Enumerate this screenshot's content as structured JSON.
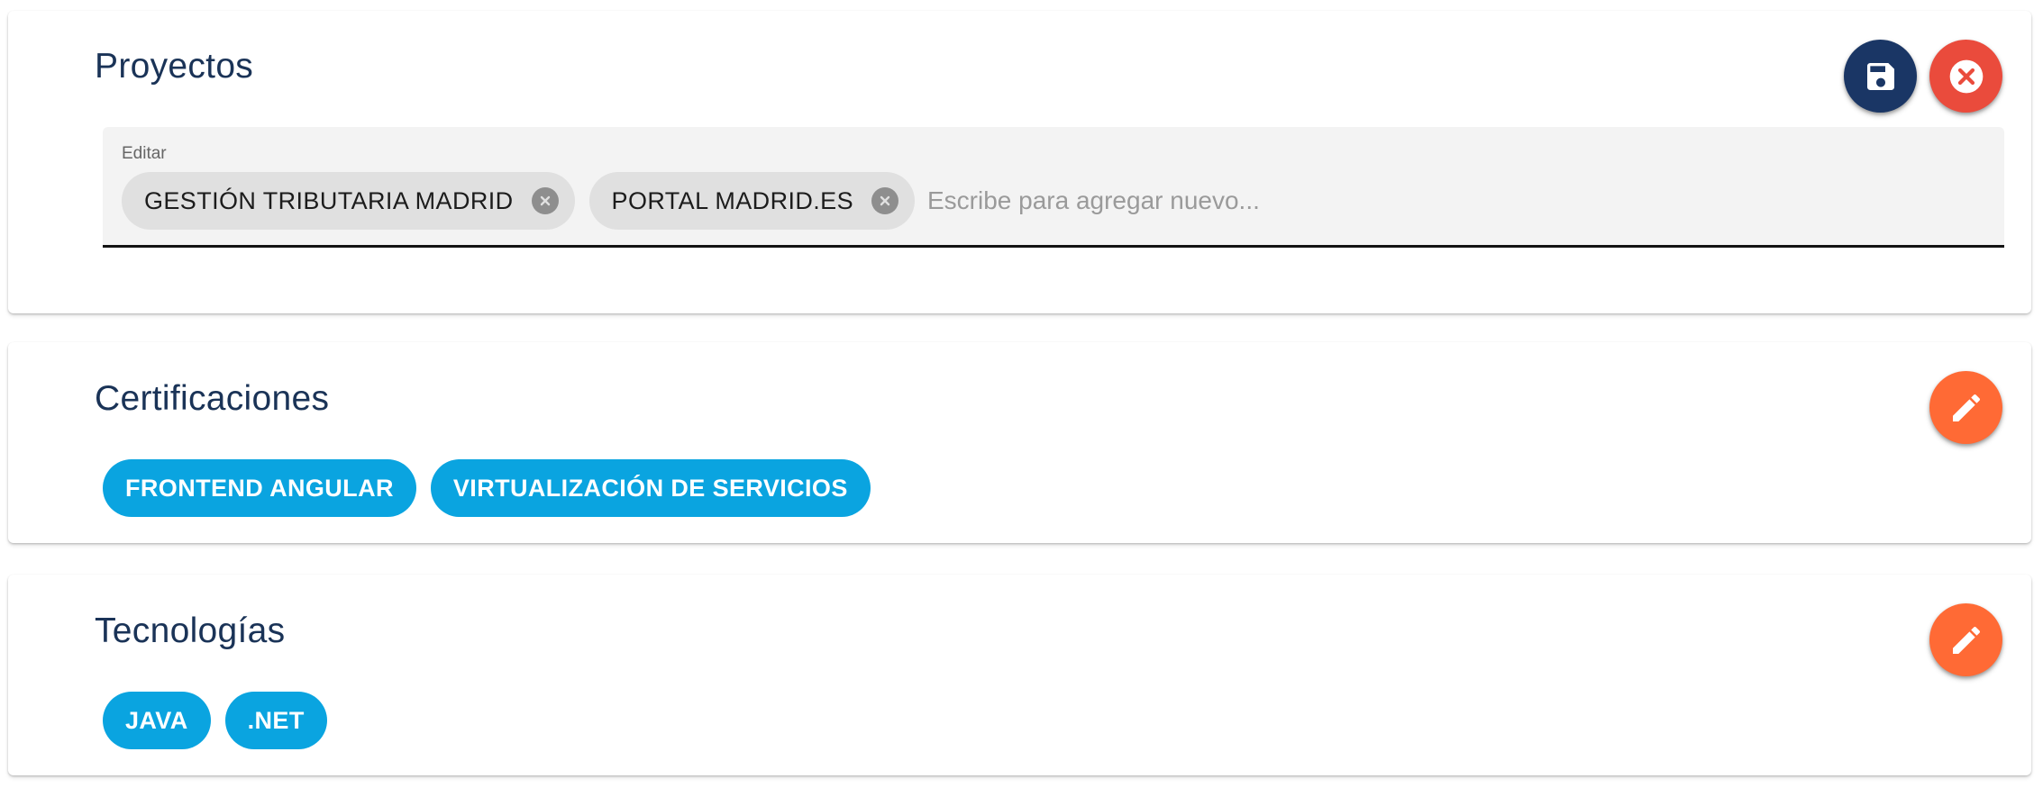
{
  "proyectos": {
    "title": "Proyectos",
    "field_label": "Editar",
    "chips": [
      "GESTIÓN TRIBUTARIA MADRID",
      "PORTAL MADRID.ES"
    ],
    "input_placeholder": "Escribe para agregar nuevo...",
    "input_value": "",
    "actions": {
      "save_icon": "floppy-disk-icon",
      "cancel_icon": "close-circle-icon"
    }
  },
  "certificaciones": {
    "title": "Certificaciones",
    "chips": [
      "FRONTEND ANGULAR",
      "VIRTUALIZACIÓN DE SERVICIOS"
    ],
    "edit_icon": "pencil-icon"
  },
  "tecnologias": {
    "title": "Tecnologías",
    "chips": [
      "JAVA",
      ".NET"
    ],
    "edit_icon": "pencil-icon"
  },
  "colors": {
    "title_text": "#1a3357",
    "save_button": "#1a3665",
    "cancel_button": "#ea4b3c",
    "edit_button": "#ff6a35",
    "chip_blue": "#0aa4e0",
    "chip_grey": "#e0e0e0"
  }
}
